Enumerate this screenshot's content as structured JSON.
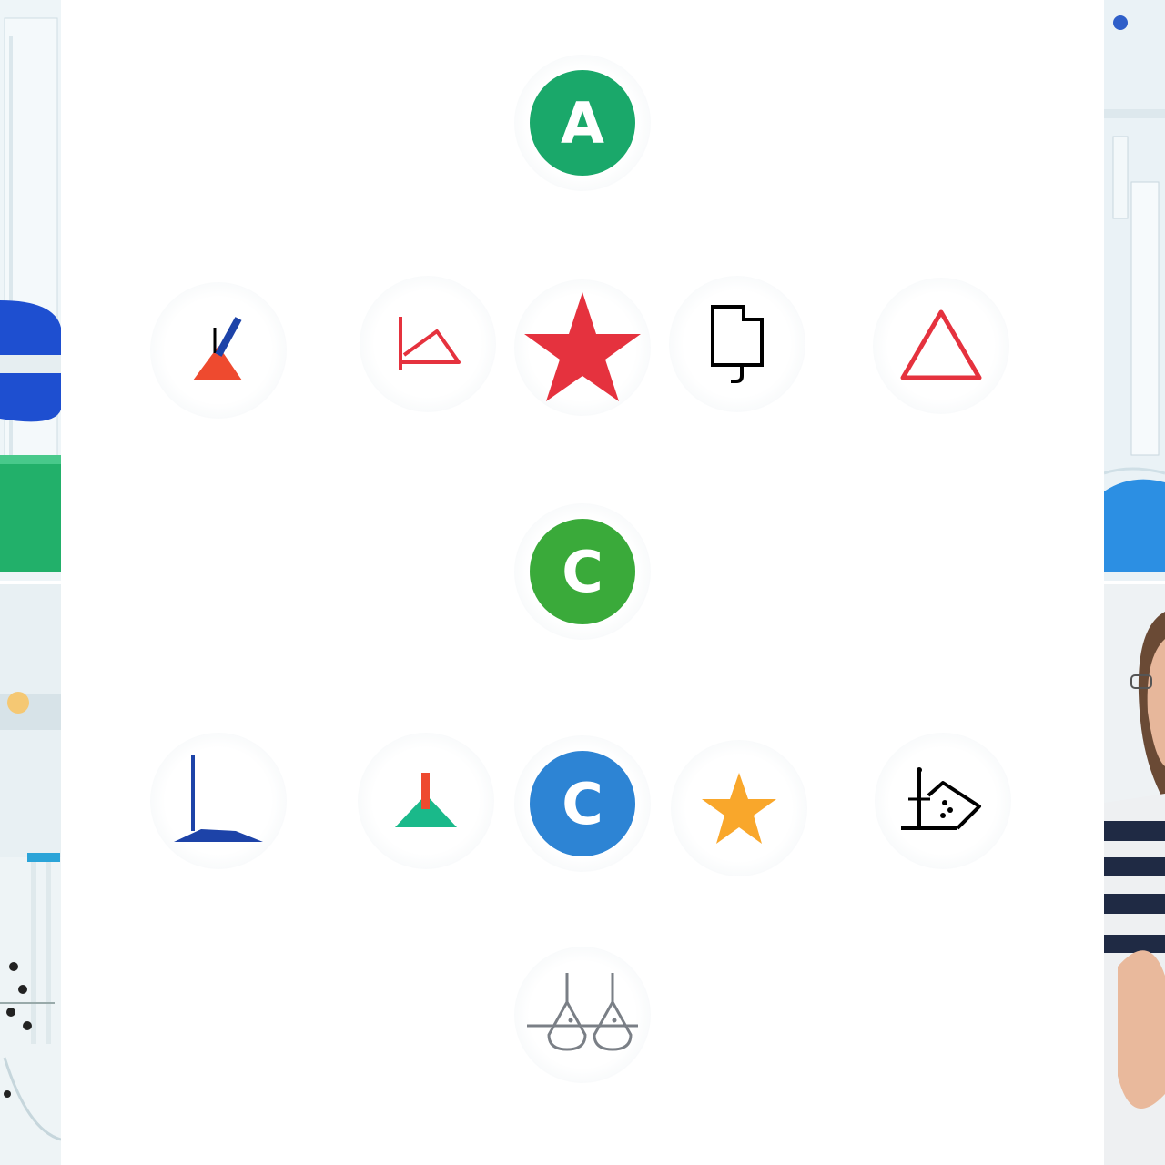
{
  "badges": {
    "top": {
      "letter": "A",
      "color": "#1aa86a",
      "icon": "letter-a-badge"
    },
    "middle": {
      "letter": "C",
      "color": "#3aaa3a",
      "icon": "letter-c-badge"
    },
    "row2_center": {
      "letter": "C",
      "color": "#2d84d4",
      "icon": "letter-c-badge"
    }
  },
  "icons": {
    "row1": [
      "beaker-stirrer-icon",
      "triangle-measure-icon",
      "star-icon",
      "document-icon",
      "triangle-outline-icon"
    ],
    "row2": [
      "tripod-stand-icon",
      "burner-icon",
      "letter-c-badge",
      "star-icon",
      "flask-stand-icon"
    ],
    "bottom": "balance-scale-icon"
  },
  "colors": {
    "red": "#e5323e",
    "orange_red": "#ee4a2f",
    "blue_dark": "#1d43a8",
    "teal": "#1ab98a",
    "orange": "#f9a72b",
    "gray": "#7a7f86"
  }
}
